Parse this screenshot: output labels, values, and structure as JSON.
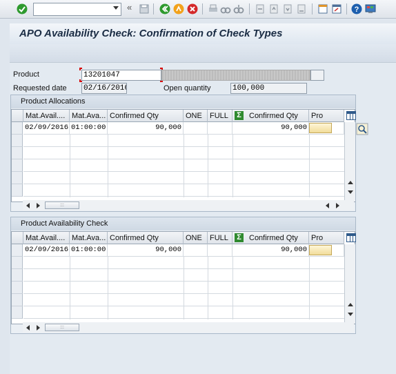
{
  "toolbar": {
    "command_value": "",
    "icons": [
      "enter-icon",
      "command-dropdown-icon",
      "history-back-icon",
      "save-icon",
      "back-icon",
      "exit-icon",
      "cancel-icon",
      "print-icon",
      "find-icon",
      "find-next-icon",
      "first-page-icon",
      "previous-page-icon",
      "next-page-icon",
      "last-page-icon",
      "new-session-icon",
      "shortcut-icon",
      "help-icon",
      "customize-layout-icon"
    ]
  },
  "title": "APO Availability Check: Confirmation of Check Types",
  "header": {
    "product_label": "Product",
    "product_value": "13201047",
    "requested_date_label": "Requested date",
    "requested_date_value": "02/16/2016",
    "open_qty_label": "Open quantity",
    "open_qty_value": "100,000"
  },
  "allocations": {
    "title": "Product Allocations",
    "columns": [
      "Mat.Avail....",
      "Mat.Ava...",
      "Confirmed Qty",
      "ONE",
      "FULL",
      "Confirmed Qty",
      "Pro"
    ],
    "rows": [
      {
        "date": "02/09/2016",
        "time": "01:00:00",
        "confirmed_qty": "90,000",
        "one": "",
        "full": "",
        "sum_confirmed_qty": "90,000"
      }
    ]
  },
  "availability": {
    "title": "Product Availability Check",
    "columns": [
      "Mat.Avail....",
      "Mat.Ava...",
      "Confirmed Qty",
      "ONE",
      "FULL",
      "Confirmed Qty",
      "Pro"
    ],
    "rows": [
      {
        "date": "02/09/2016",
        "time": "01:00:00",
        "confirmed_qty": "90,000",
        "one": "",
        "full": "",
        "sum_confirmed_qty": "90,000"
      }
    ]
  },
  "colors": {
    "title_text": "#1a2c44",
    "background": "#dfe6ee",
    "enter_green": "#2e9a2e",
    "exit_orange": "#f2a21b",
    "cancel_red": "#d4292a",
    "help_blue": "#1d5fae"
  }
}
